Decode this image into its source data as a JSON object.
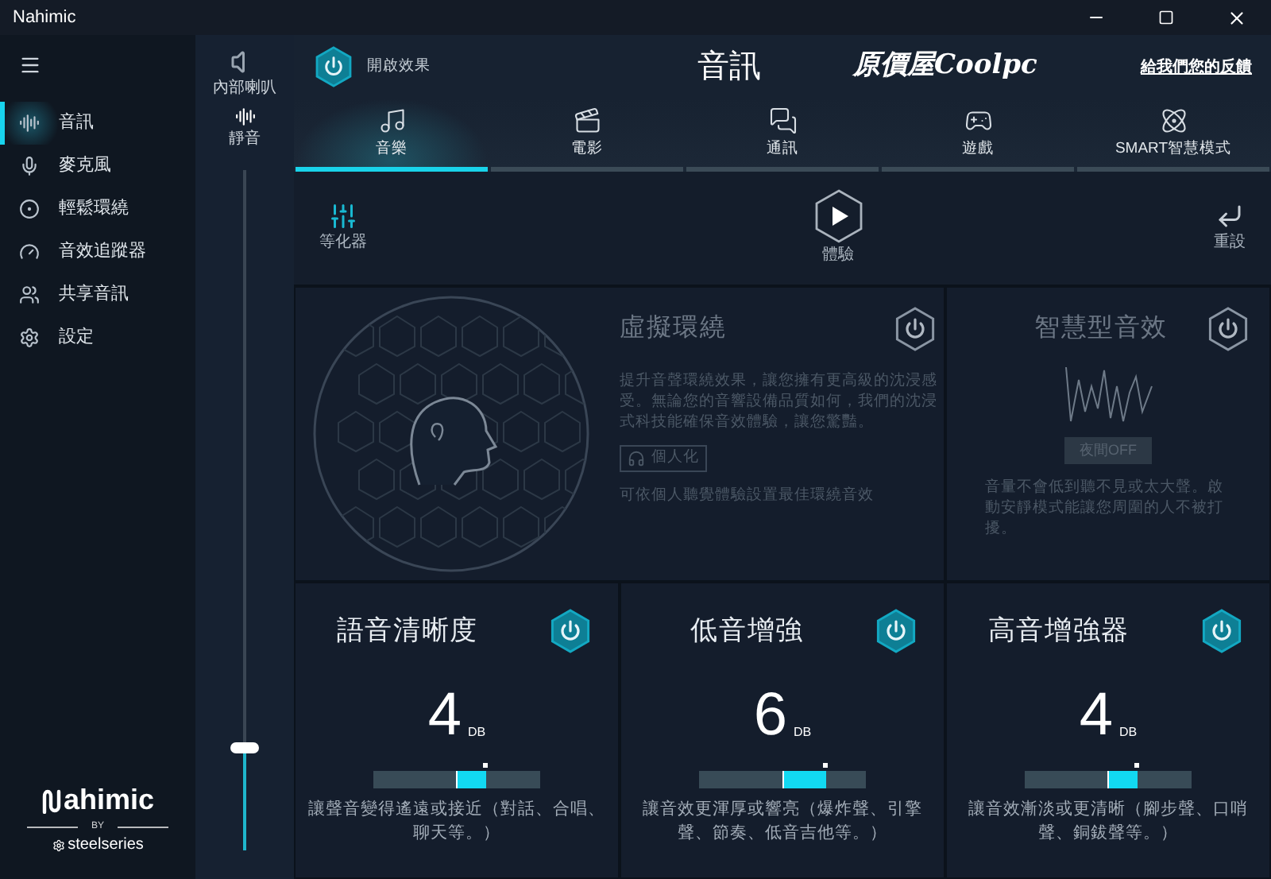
{
  "window": {
    "title": "Nahimic"
  },
  "sidebar": {
    "items": [
      {
        "label": "音訊",
        "selected": true,
        "kind": "audio"
      },
      {
        "label": "麥克風",
        "selected": false,
        "kind": "mic"
      },
      {
        "label": "輕鬆環繞",
        "selected": false,
        "kind": "surround"
      },
      {
        "label": "音效追蹤器",
        "selected": false,
        "kind": "tracker"
      },
      {
        "label": "共享音訊",
        "selected": false,
        "kind": "share"
      },
      {
        "label": "設定",
        "selected": false,
        "kind": "settings"
      }
    ],
    "brand": {
      "name": "ahimic",
      "by": "BY",
      "maker": "steelseries"
    }
  },
  "device": {
    "name": "內部喇叭",
    "mute_label": "靜音",
    "volume": {
      "level": 0.15
    }
  },
  "header": {
    "effect_toggle": {
      "label": "開啟效果",
      "on": true
    },
    "title": "音訊",
    "logo": "原價屋Coolpc",
    "feedback_link": "給我們您的反饋"
  },
  "tabs": [
    {
      "label": "音樂",
      "selected": true,
      "kind": "music"
    },
    {
      "label": "電影",
      "selected": false,
      "kind": "movie"
    },
    {
      "label": "通訊",
      "selected": false,
      "kind": "chat"
    },
    {
      "label": "遊戲",
      "selected": false,
      "kind": "game"
    },
    {
      "label": "SMART智慧模式",
      "selected": false,
      "kind": "smart"
    }
  ],
  "toolbar": {
    "equalizer": "等化器",
    "play": "體驗",
    "reset": "重設"
  },
  "virtual_surround": {
    "title": "虛擬環繞",
    "on": false,
    "description": "提升音聲環繞效果，讓您擁有更高級的沈浸感受。無論您的音響設備品質如何，我們的沈浸式科技能確保音效體驗，讓您驚豔。",
    "personalize": "個人化",
    "note": "可依個人聽覺體驗設置最佳環繞音效"
  },
  "smart_volume": {
    "title": "智慧型音效",
    "on": false,
    "mode": "夜間OFF",
    "description": "音量不會低到聽不見或太大聲。啟動安靜模式能讓您周圍的人不被打擾。"
  },
  "effects": [
    {
      "title": "語音清晰度",
      "on": true,
      "value": "4",
      "unit": "DB",
      "level": 0.68,
      "description": "讓聲音變得遙遠或接近（對話、合唱、聊天等。）"
    },
    {
      "title": "低音增強",
      "on": true,
      "value": "6",
      "unit": "DB",
      "level": 0.76,
      "description": "讓音效更渾厚或響亮（爆炸聲、引擎聲、節奏、低音吉他等。）"
    },
    {
      "title": "高音增強器",
      "on": true,
      "value": "4",
      "unit": "DB",
      "level": 0.68,
      "description": "讓音效漸淡或更清晰（腳步聲、口哨聲、銅鈸聲等。）"
    }
  ]
}
